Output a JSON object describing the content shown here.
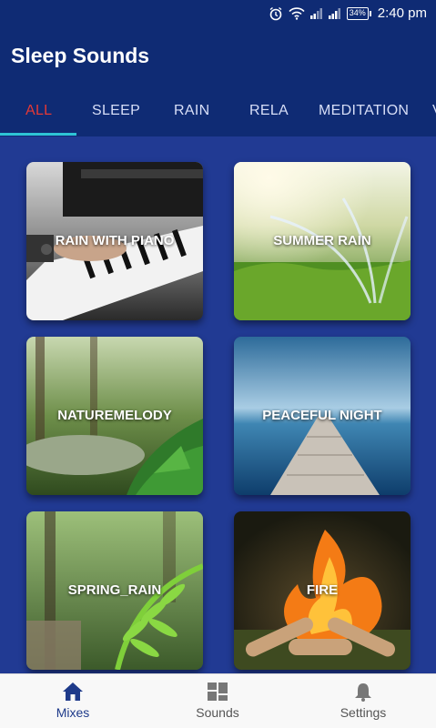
{
  "status_bar": {
    "battery": "34%",
    "time": "2:40 pm"
  },
  "app": {
    "title": "Sleep Sounds"
  },
  "tabs": [
    {
      "label": "ALL",
      "active": true
    },
    {
      "label": "SLEEP",
      "active": false
    },
    {
      "label": "RAIN",
      "active": false
    },
    {
      "label": "RELA",
      "active": false
    },
    {
      "label": "MEDITATION",
      "active": false
    },
    {
      "label": "V",
      "active": false
    }
  ],
  "cards": [
    {
      "label": "RAIN WITH PIANO"
    },
    {
      "label": "SUMMER RAIN"
    },
    {
      "label": "NATUREMELODY"
    },
    {
      "label": "PEACEFUL NIGHT"
    },
    {
      "label": "SPRING_RAIN"
    },
    {
      "label": "FIRE"
    }
  ],
  "bottom_nav": [
    {
      "label": "Mixes",
      "icon": "home-icon",
      "active": true
    },
    {
      "label": "Sounds",
      "icon": "grid-icon",
      "active": false
    },
    {
      "label": "Settings",
      "icon": "bell-icon",
      "active": false
    }
  ],
  "colors": {
    "header": "#0f2b74",
    "background": "#213a93",
    "active_tab": "#e53935",
    "tab_indicator": "#2ec4d6"
  }
}
